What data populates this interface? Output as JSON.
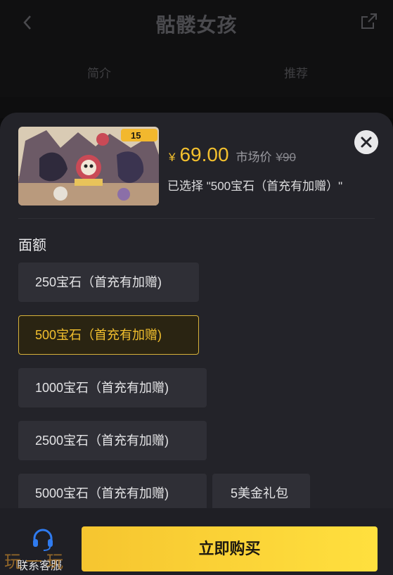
{
  "header": {
    "title": "骷髅女孩",
    "back_icon": "chevron-left-icon",
    "share_icon": "share-icon"
  },
  "tabs": [
    {
      "label": "简介"
    },
    {
      "label": "推荐"
    }
  ],
  "product": {
    "thumbnail_icon": "game-cover-image",
    "badge_text": "15",
    "currency_symbol": "¥",
    "price": "69.00",
    "market_label": "市场价",
    "market_price": "¥90",
    "selected_text": "已选择 \"500宝石（首充有加赠）\""
  },
  "options_section": {
    "label": "面额",
    "options": [
      {
        "label": "250宝石（首充有加赠)"
      },
      {
        "label": "500宝石（首充有加赠)",
        "selected": true
      },
      {
        "label": "1000宝石（首充有加赠)"
      },
      {
        "label": "2500宝石（首充有加赠)"
      },
      {
        "label": "5000宝石（首充有加赠)"
      },
      {
        "label": "5美金礼包"
      }
    ]
  },
  "footer": {
    "customer_service_label": "联系客服",
    "customer_service_icon": "headset-icon",
    "buy_label": "立即购买"
  },
  "watermark": "玩一玩",
  "colors": {
    "accent": "#f3c02e",
    "sheet_bg": "#232329",
    "option_bg": "#2f2f36",
    "selected_border": "#d6b13a",
    "cs_icon": "#2f7bf0"
  }
}
